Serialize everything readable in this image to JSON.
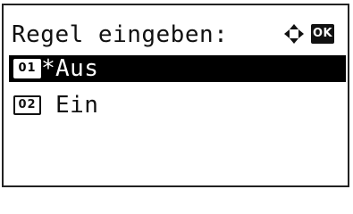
{
  "header": {
    "title": "Regel eingeben:",
    "nav_icon": "four-way-arrow-icon",
    "ok_label": "OK"
  },
  "menu": {
    "items": [
      {
        "number": "01",
        "marker": "*",
        "label": "Aus",
        "selected": true
      },
      {
        "number": "02",
        "marker": "",
        "label": "Ein",
        "selected": false
      }
    ]
  }
}
